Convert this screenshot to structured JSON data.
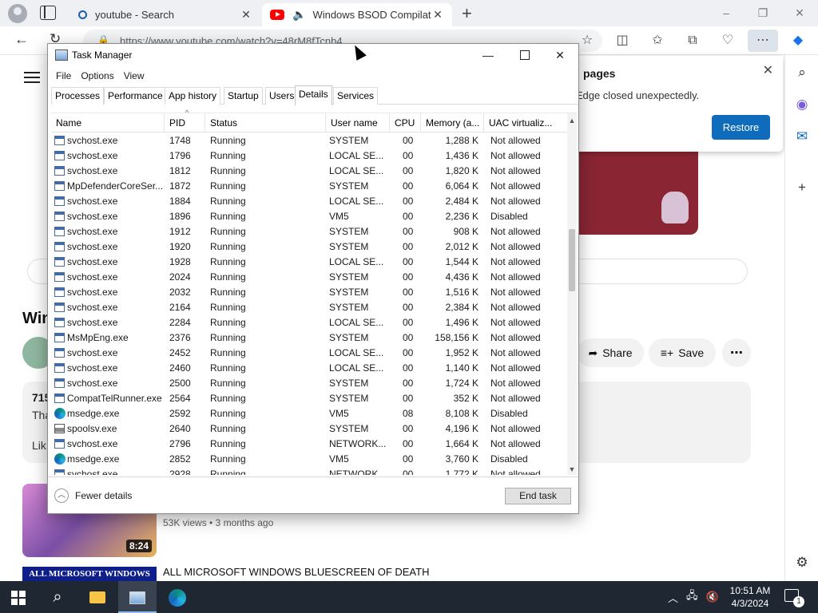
{
  "browser": {
    "tabs": [
      {
        "title": "youtube - Search",
        "icon": "search-icon"
      },
      {
        "title": "Windows BSOD Compilation",
        "icon": "youtube-icon"
      }
    ],
    "address": "https://www.youtube.com/watch?v=48rM8fTcnb4",
    "window_controls": [
      "–",
      "❐",
      "✕"
    ]
  },
  "restore_popup": {
    "title": "pages",
    "message": "ft Edge closed unexpectedly.",
    "button": "Restore"
  },
  "youtube": {
    "video_title": "Win",
    "share_label": "Share",
    "save_label": "Save",
    "desc_line1": "715",
    "desc_line2": "Tha",
    "desc_line3": "Lik",
    "rec1_duration": "8:24",
    "rec1_meta": "53K views • 3 months ago",
    "rec2_thumb_text": "ALL MICROSOFT WINDOWS",
    "rec2_title": "ALL MICROSOFT WINDOWS BLUESCREEN OF DEATH"
  },
  "task_manager": {
    "title": "Task Manager",
    "menu": [
      "File",
      "Options",
      "View"
    ],
    "tabs": [
      "Processes",
      "Performance",
      "App history",
      "Startup",
      "Users",
      "Details",
      "Services"
    ],
    "active_tab": "Details",
    "columns": [
      "Name",
      "PID",
      "Status",
      "User name",
      "CPU",
      "Memory (a...",
      "UAC virtualiz..."
    ],
    "rows": [
      {
        "icon": "service",
        "name": "svchost.exe",
        "pid": "1748",
        "status": "Running",
        "user": "SYSTEM",
        "cpu": "00",
        "mem": "1,288 K",
        "uac": "Not allowed"
      },
      {
        "icon": "service",
        "name": "svchost.exe",
        "pid": "1796",
        "status": "Running",
        "user": "LOCAL SE...",
        "cpu": "00",
        "mem": "1,436 K",
        "uac": "Not allowed"
      },
      {
        "icon": "service",
        "name": "svchost.exe",
        "pid": "1812",
        "status": "Running",
        "user": "LOCAL SE...",
        "cpu": "00",
        "mem": "1,820 K",
        "uac": "Not allowed"
      },
      {
        "icon": "service",
        "name": "MpDefenderCoreSer...",
        "pid": "1872",
        "status": "Running",
        "user": "SYSTEM",
        "cpu": "00",
        "mem": "6,064 K",
        "uac": "Not allowed"
      },
      {
        "icon": "service",
        "name": "svchost.exe",
        "pid": "1884",
        "status": "Running",
        "user": "LOCAL SE...",
        "cpu": "00",
        "mem": "2,484 K",
        "uac": "Not allowed"
      },
      {
        "icon": "service",
        "name": "svchost.exe",
        "pid": "1896",
        "status": "Running",
        "user": "VM5",
        "cpu": "00",
        "mem": "2,236 K",
        "uac": "Disabled"
      },
      {
        "icon": "service",
        "name": "svchost.exe",
        "pid": "1912",
        "status": "Running",
        "user": "SYSTEM",
        "cpu": "00",
        "mem": "908 K",
        "uac": "Not allowed"
      },
      {
        "icon": "service",
        "name": "svchost.exe",
        "pid": "1920",
        "status": "Running",
        "user": "SYSTEM",
        "cpu": "00",
        "mem": "2,012 K",
        "uac": "Not allowed"
      },
      {
        "icon": "service",
        "name": "svchost.exe",
        "pid": "1928",
        "status": "Running",
        "user": "LOCAL SE...",
        "cpu": "00",
        "mem": "1,544 K",
        "uac": "Not allowed"
      },
      {
        "icon": "service",
        "name": "svchost.exe",
        "pid": "2024",
        "status": "Running",
        "user": "SYSTEM",
        "cpu": "00",
        "mem": "4,436 K",
        "uac": "Not allowed"
      },
      {
        "icon": "service",
        "name": "svchost.exe",
        "pid": "2032",
        "status": "Running",
        "user": "SYSTEM",
        "cpu": "00",
        "mem": "1,516 K",
        "uac": "Not allowed"
      },
      {
        "icon": "service",
        "name": "svchost.exe",
        "pid": "2164",
        "status": "Running",
        "user": "SYSTEM",
        "cpu": "00",
        "mem": "2,384 K",
        "uac": "Not allowed"
      },
      {
        "icon": "service",
        "name": "svchost.exe",
        "pid": "2284",
        "status": "Running",
        "user": "LOCAL SE...",
        "cpu": "00",
        "mem": "1,496 K",
        "uac": "Not allowed"
      },
      {
        "icon": "service",
        "name": "MsMpEng.exe",
        "pid": "2376",
        "status": "Running",
        "user": "SYSTEM",
        "cpu": "00",
        "mem": "158,156 K",
        "uac": "Not allowed"
      },
      {
        "icon": "service",
        "name": "svchost.exe",
        "pid": "2452",
        "status": "Running",
        "user": "LOCAL SE...",
        "cpu": "00",
        "mem": "1,952 K",
        "uac": "Not allowed"
      },
      {
        "icon": "service",
        "name": "svchost.exe",
        "pid": "2460",
        "status": "Running",
        "user": "LOCAL SE...",
        "cpu": "00",
        "mem": "1,140 K",
        "uac": "Not allowed"
      },
      {
        "icon": "service",
        "name": "svchost.exe",
        "pid": "2500",
        "status": "Running",
        "user": "SYSTEM",
        "cpu": "00",
        "mem": "1,724 K",
        "uac": "Not allowed"
      },
      {
        "icon": "service",
        "name": "CompatTelRunner.exe",
        "pid": "2564",
        "status": "Running",
        "user": "SYSTEM",
        "cpu": "00",
        "mem": "352 K",
        "uac": "Not allowed"
      },
      {
        "icon": "edge",
        "name": "msedge.exe",
        "pid": "2592",
        "status": "Running",
        "user": "VM5",
        "cpu": "08",
        "mem": "8,108 K",
        "uac": "Disabled"
      },
      {
        "icon": "printer",
        "name": "spoolsv.exe",
        "pid": "2640",
        "status": "Running",
        "user": "SYSTEM",
        "cpu": "00",
        "mem": "4,196 K",
        "uac": "Not allowed"
      },
      {
        "icon": "service",
        "name": "svchost.exe",
        "pid": "2796",
        "status": "Running",
        "user": "NETWORK...",
        "cpu": "00",
        "mem": "1,664 K",
        "uac": "Not allowed"
      },
      {
        "icon": "edge",
        "name": "msedge.exe",
        "pid": "2852",
        "status": "Running",
        "user": "VM5",
        "cpu": "00",
        "mem": "3,760 K",
        "uac": "Disabled"
      },
      {
        "icon": "service",
        "name": "svchost.exe",
        "pid": "2928",
        "status": "Running",
        "user": "NETWORK...",
        "cpu": "00",
        "mem": "1,772 K",
        "uac": "Not allowed"
      }
    ],
    "fewer_details": "Fewer details",
    "end_task": "End task"
  },
  "taskbar": {
    "time": "10:51 AM",
    "date": "4/3/2024",
    "notifications": "1"
  }
}
